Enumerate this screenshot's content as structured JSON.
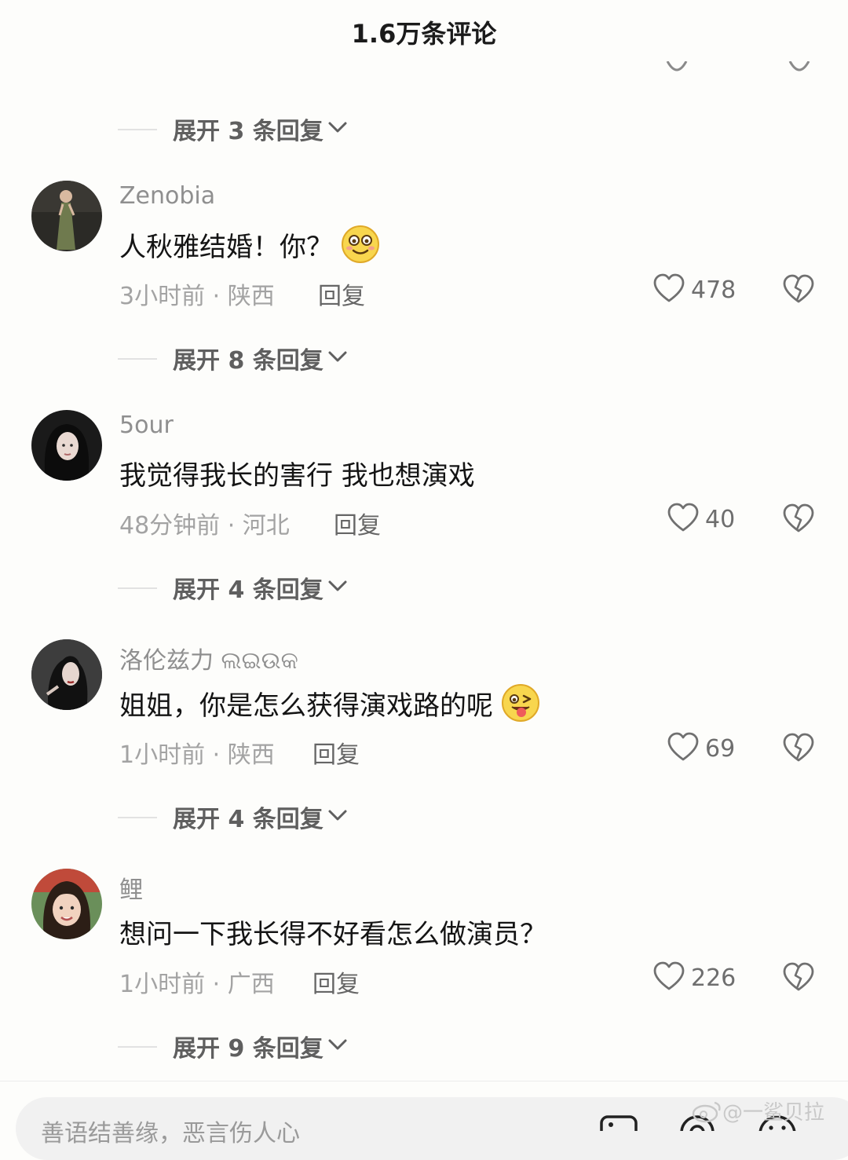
{
  "header": {
    "title": "1.6万条评论"
  },
  "expand_rows": [
    {
      "label": "展开 3 条回复"
    },
    {
      "label": "展开 8 条回复"
    },
    {
      "label": "展开 4 条回复"
    },
    {
      "label": "展开 4 条回复"
    },
    {
      "label": "展开 9 条回复"
    }
  ],
  "comments": [
    {
      "username": "Zenobia",
      "text": "人秋雅结婚！你？",
      "emoji": "smiling-face-emoji",
      "meta": "3小时前 · 陕西",
      "reply_label": "回复",
      "likes": "478"
    },
    {
      "username": "5our",
      "text": "我觉得我长的害行 我也想演戏",
      "meta": "48分钟前 · 河北",
      "reply_label": "回复",
      "likes": "40"
    },
    {
      "username": "洛伦兹力 ଲଇଉକ",
      "text": "姐姐，你是怎么获得演戏路的呢",
      "emoji": "winking-tongue-emoji",
      "meta": "1小时前 · 陕西",
      "reply_label": "回复",
      "likes": "69"
    },
    {
      "username": "鲤",
      "text": "想问一下我长得不好看怎么做演员？",
      "meta": "1小时前 · 广西",
      "reply_label": "回复",
      "likes": "226"
    }
  ],
  "input": {
    "placeholder": "善语结善缘，恶言伤人心"
  },
  "watermark": {
    "text": "@一鲨贝拉"
  }
}
